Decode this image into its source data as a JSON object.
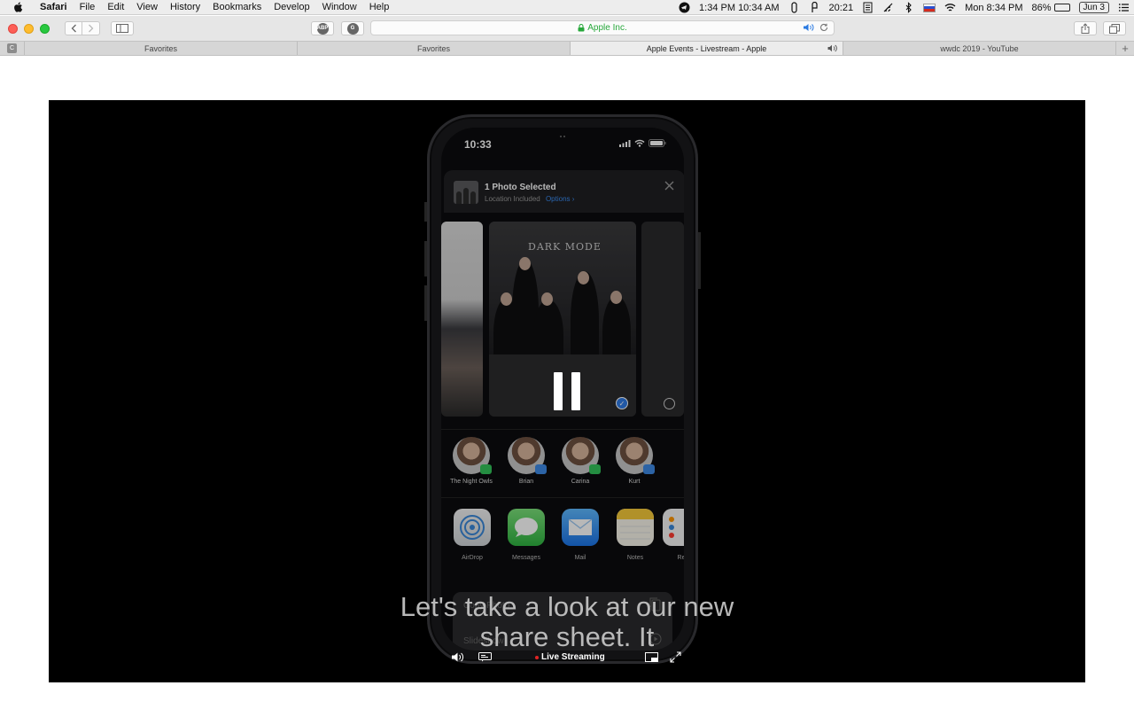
{
  "menubar": {
    "app_name": "Safari",
    "items": [
      "File",
      "Edit",
      "View",
      "History",
      "Bookmarks",
      "Develop",
      "Window",
      "Help"
    ],
    "clock_dual": "1:34 PM 10:34 AM",
    "timer": "20:21",
    "datetime": "Mon 8:34 PM",
    "battery_percent": "86%",
    "battery_level": 0.86,
    "date_badge": "Jun 3"
  },
  "toolbar": {
    "ext1_badge": "ABP",
    "ext2_badge": "G",
    "url": "Apple Inc.",
    "accent_color": "#27a83b"
  },
  "tabs": {
    "pinned_letter": "C",
    "items": [
      {
        "label": "Favorites"
      },
      {
        "label": "Favorites"
      },
      {
        "label": "Apple Events - Livestream - Apple"
      },
      {
        "label": "wwdc 2019 - YouTube"
      }
    ],
    "new_tab": "+"
  },
  "video": {
    "phone": {
      "time": "10:33",
      "sheet_title": "1 Photo Selected",
      "sheet_sub": "Location Included",
      "sheet_options": "Options ›",
      "photo_caption": "DARK MODE",
      "people": [
        {
          "name": "The Night Owls",
          "badge": "msg"
        },
        {
          "name": "Brian",
          "badge": "mail"
        },
        {
          "name": "Carina",
          "badge": "msg"
        },
        {
          "name": "Kurt",
          "badge": "mail"
        }
      ],
      "apps": [
        {
          "name": "AirDrop"
        },
        {
          "name": "Messages"
        },
        {
          "name": "Mail"
        },
        {
          "name": "Notes"
        },
        {
          "name": "Re"
        }
      ],
      "actions": [
        "Copy Photo",
        "Slideshow"
      ]
    },
    "caption_line1": "Let's take a look at our new",
    "caption_line2": "share sheet.  It",
    "live_label": "Live Streaming"
  }
}
